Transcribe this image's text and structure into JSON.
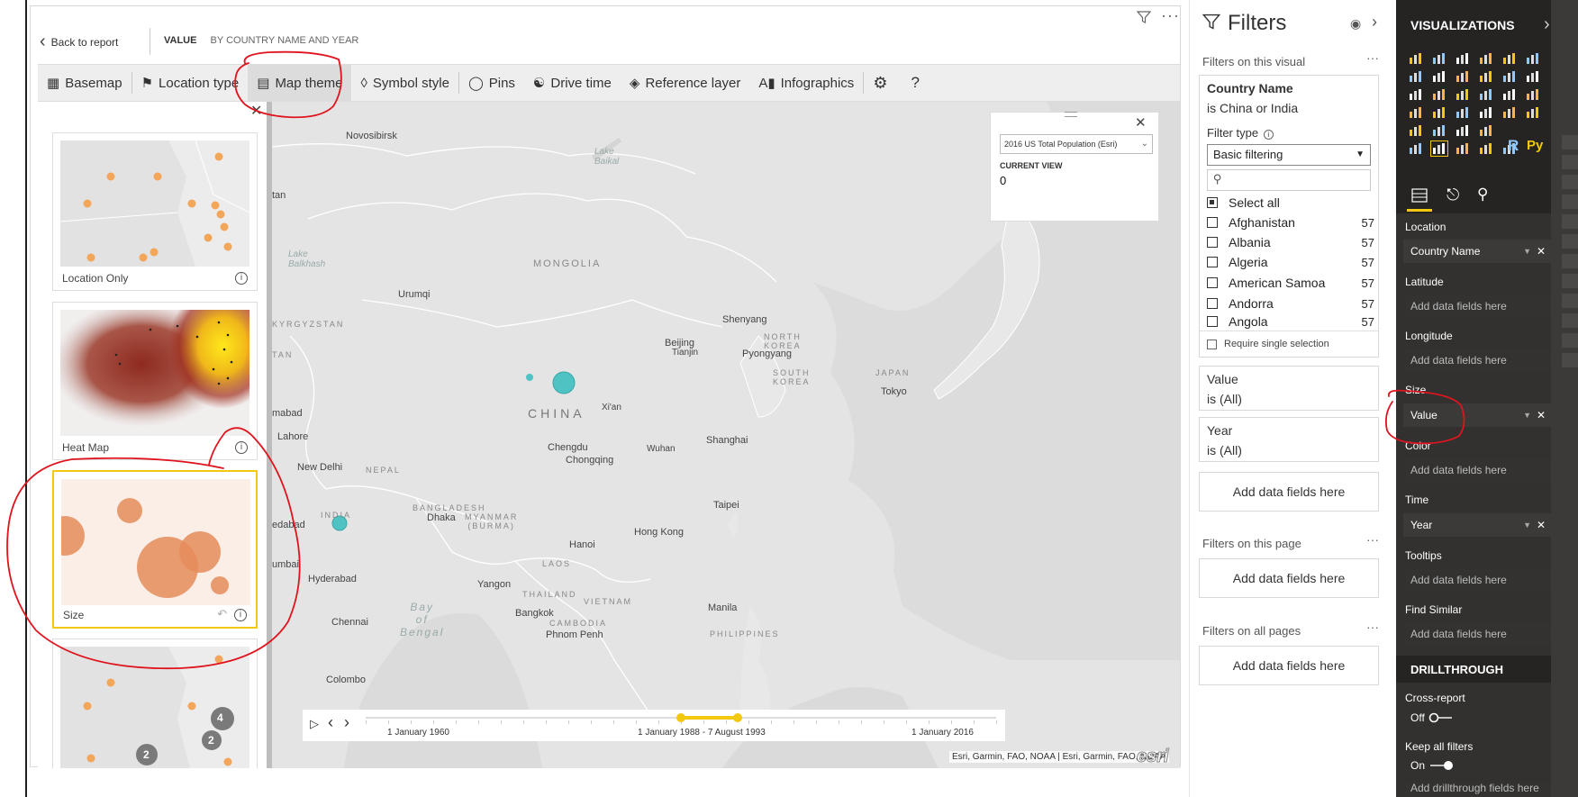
{
  "visual_header": {
    "back_label": "Back to report",
    "title_value": "VALUE",
    "title_rest": "BY COUNTRY NAME AND YEAR"
  },
  "toolbar": {
    "basemap": "Basemap",
    "location_type": "Location type",
    "map_theme": "Map theme",
    "symbol_style": "Symbol style",
    "pins": "Pins",
    "drive_time": "Drive time",
    "reference_layer": "Reference layer",
    "infographics": "Infographics",
    "help": "?"
  },
  "themes": {
    "location_only": "Location Only",
    "heat_map": "Heat Map",
    "size": "Size",
    "cluster_a": "4",
    "cluster_b": "2",
    "cluster_c": "2"
  },
  "ref_panel": {
    "dropdown": "2016 US Total Population (Esri)",
    "current_view_label": "CURRENT VIEW",
    "current_view_value": "0"
  },
  "map_labels": {
    "novosibirsk": "Novosibirsk",
    "lake_baikal": "Lake\nBaikal",
    "tan": "tan",
    "mongolia": "MONGOLIA",
    "lake_balkhash": "Lake\nBalkhash",
    "urumqi": "Urumqi",
    "kyrgyzstan": "KYRGYZSTAN",
    "tan2": "TAN",
    "shenyang": "Shenyang",
    "beijing": "Beijing",
    "tianjin": "Tianjin",
    "north_korea": "NORTH\nKOREA",
    "pyongyang": "Pyongyang",
    "south_korea": "SOUTH\nKOREA",
    "japan": "JAPAN",
    "tokyo": "Tokyo",
    "china": "CHINA",
    "xian": "Xi'an",
    "mabad": "mabad",
    "lahore": "Lahore",
    "chengdu": "Chengdu",
    "chongqing": "Chongqing",
    "wuhan": "Wuhan",
    "shanghai": "Shanghai",
    "new_delhi": "New Delhi",
    "nepal": "NEPAL",
    "taipei": "Taipei",
    "bangladesh": "BANGLADESH",
    "dhaka": "Dhaka",
    "myanmar": "MYANMAR\n(BURMA)",
    "india": "INDIA",
    "edabad": "edabad",
    "hong_kong": "Hong Kong",
    "hanoi": "Hanoi",
    "umbai": "umbai",
    "laos": "LAOS",
    "hyderabad": "Hyderabad",
    "yangon": "Yangon",
    "thailand": "THAILAND",
    "vietnam": "VIETNAM",
    "bangkok": "Bangkok",
    "cambodia": "CAMBODIA",
    "phnom_penh": "Phnom Penh",
    "manila": "Manila",
    "philippines": "PHILIPPINES",
    "bay_of_bengal": "Bay\nof\nBengal",
    "chennai": "Chennai",
    "colombo": "Colombo"
  },
  "timeline": {
    "start": "1 January 1960",
    "range": "1 January 1988 - 7 August 1993",
    "end": "1 January 2016",
    "range_start_fraction": 0.5,
    "range_end_fraction": 0.59
  },
  "attribution": "Esri, Garmin, FAO, NOAA | Esri, Garmin, FAO, NOAA",
  "esri_logo": "esri",
  "filters": {
    "title": "Filters",
    "on_visual": "Filters on this visual",
    "country_card": {
      "field": "Country Name",
      "condition": "is China or India",
      "filter_type_label": "Filter type",
      "filter_type_value": "Basic filtering",
      "select_all": "Select all",
      "items": [
        {
          "name": "Afghanistan",
          "count": "57"
        },
        {
          "name": "Albania",
          "count": "57"
        },
        {
          "name": "Algeria",
          "count": "57"
        },
        {
          "name": "American Samoa",
          "count": "57"
        },
        {
          "name": "Andorra",
          "count": "57"
        },
        {
          "name": "Angola",
          "count": "57"
        }
      ],
      "require_single": "Require single selection"
    },
    "value_card": {
      "field": "Value",
      "condition": "is (All)"
    },
    "year_card": {
      "field": "Year",
      "condition": "is (All)"
    },
    "add_fields": "Add data fields here",
    "on_page": "Filters on this page",
    "on_all_pages": "Filters on all pages"
  },
  "viz": {
    "title": "VISUALIZATIONS",
    "r_icon": "R",
    "py_icon": "Py",
    "wells": {
      "location": "Location",
      "location_field": "Country Name",
      "latitude": "Latitude",
      "longitude": "Longitude",
      "size": "Size",
      "size_field": "Value",
      "color": "Color",
      "time": "Time",
      "time_field": "Year",
      "tooltips": "Tooltips",
      "find_similar": "Find Similar",
      "add_fields": "Add data fields here"
    },
    "drillthrough": "DRILLTHROUGH",
    "cross_report": "Cross-report",
    "cross_report_state": "Off",
    "keep_filters": "Keep all filters",
    "keep_filters_state": "On",
    "add_drillthrough": "Add drillthrough fields here"
  },
  "colors": {
    "accent_yellow": "#f2c811",
    "bubble_teal": "#4fc3c3",
    "annotation_red": "#e0141e",
    "orange": "#f3a65a"
  }
}
